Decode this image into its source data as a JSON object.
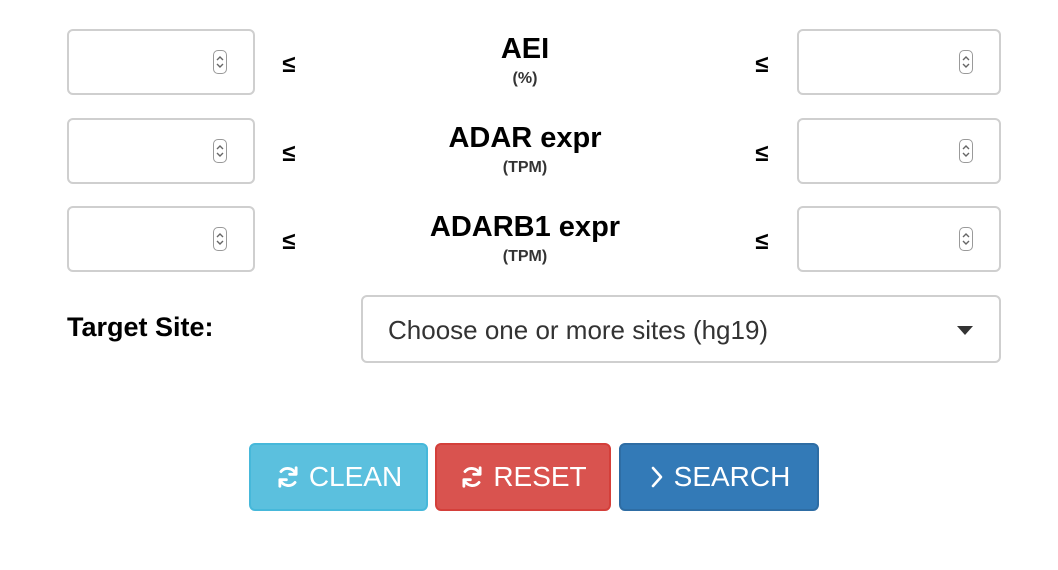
{
  "filters": [
    {
      "name": "AEI",
      "unit": "(%)",
      "min_value": "",
      "max_value": ""
    },
    {
      "name": "ADAR expr",
      "unit": "(TPM)",
      "min_value": "",
      "max_value": ""
    },
    {
      "name": "ADARB1 expr",
      "unit": "(TPM)",
      "min_value": "",
      "max_value": ""
    }
  ],
  "comparator": "≤",
  "target_site": {
    "label": "Target Site:",
    "placeholder": "Choose one or more sites (hg19)"
  },
  "buttons": {
    "clean": "CLEAN",
    "reset": "RESET",
    "search": "SEARCH"
  },
  "icons": {
    "spinner": "up-down-spinner-icon",
    "clean": "refresh-icon",
    "reset": "refresh-icon",
    "search": "chevron-right-icon",
    "select": "caret-down-icon"
  },
  "colors": {
    "clean": "#5bc0de",
    "reset": "#d9534f",
    "search": "#337ab7",
    "input_border": "#cfcfcf"
  }
}
